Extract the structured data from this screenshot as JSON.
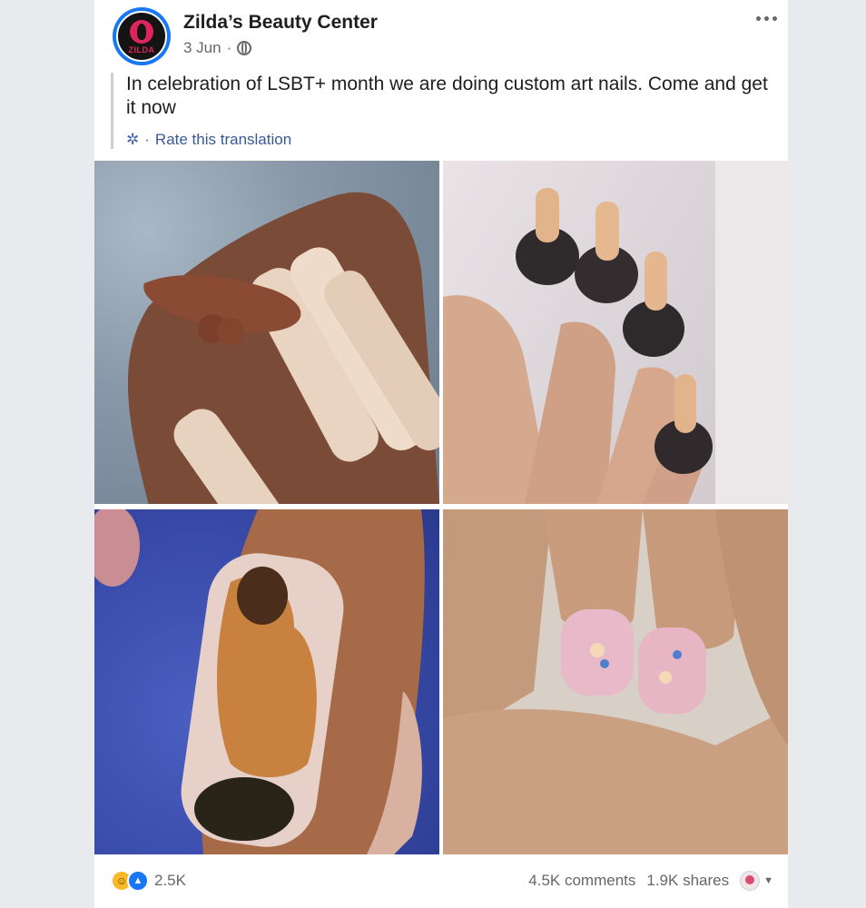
{
  "post": {
    "page_name": "Zilda’s Beauty Center",
    "avatar_text": "ZILDA",
    "date": "3 Jun",
    "separator": "·",
    "text": "In celebration of LSBT+ month we are doing custom art nails. Come and get it now",
    "rate_translation": "Rate this translation"
  },
  "photos": [
    {
      "name": "photo-1"
    },
    {
      "name": "photo-2"
    },
    {
      "name": "photo-3"
    },
    {
      "name": "photo-4"
    }
  ],
  "footer": {
    "reaction_count": "2.5K",
    "comments": "4.5K comments",
    "shares": "1.9K shares"
  },
  "icons": {
    "more": "more-options-icon",
    "globe": "globe-icon",
    "gear": "gear-icon",
    "haha": "haha-reaction-icon",
    "like": "like-reaction-icon",
    "caret": "caret-down-icon"
  },
  "colors": {
    "link": "#385898",
    "like_blue": "#1877f2",
    "haha_yellow": "#f7b928",
    "brand_pink": "#e0245e"
  }
}
